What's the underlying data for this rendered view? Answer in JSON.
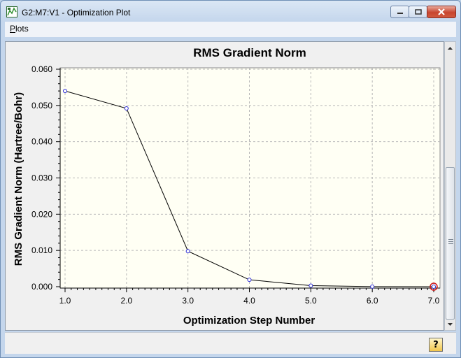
{
  "window": {
    "title": "G2:M7:V1 - Optimization Plot",
    "minimize_icon": "minimize-icon",
    "maximize_icon": "maximize-icon",
    "close_icon": "close-icon"
  },
  "menu": {
    "items": [
      {
        "label": "Plots",
        "mnemonic": "P"
      }
    ]
  },
  "help": {
    "label": "?"
  },
  "chart_data": {
    "type": "line",
    "title": "RMS Gradient Norm",
    "xlabel": "Optimization Step Number",
    "ylabel": "RMS Gradient Norm (Hartree/Bohr)",
    "x": [
      1,
      2,
      3,
      4,
      5,
      6,
      7
    ],
    "values": [
      0.054,
      0.0492,
      0.0098,
      0.0019,
      0.0003,
      3e-05,
      0.0
    ],
    "xlim": [
      1.0,
      7.0
    ],
    "ylim": [
      0.0,
      0.06
    ],
    "xticks": [
      "1.0",
      "2.0",
      "3.0",
      "4.0",
      "5.0",
      "6.0",
      "7.0"
    ],
    "yticks": [
      "0.000",
      "0.010",
      "0.020",
      "0.030",
      "0.040",
      "0.050",
      "0.060"
    ],
    "grid": true,
    "highlighted_point_index": 6,
    "colors": {
      "line": "#000000",
      "marker": "#2b2bd6",
      "highlight": "#d01818",
      "plot_bg": "#fffff4",
      "grid": "#b8b8b8"
    }
  }
}
